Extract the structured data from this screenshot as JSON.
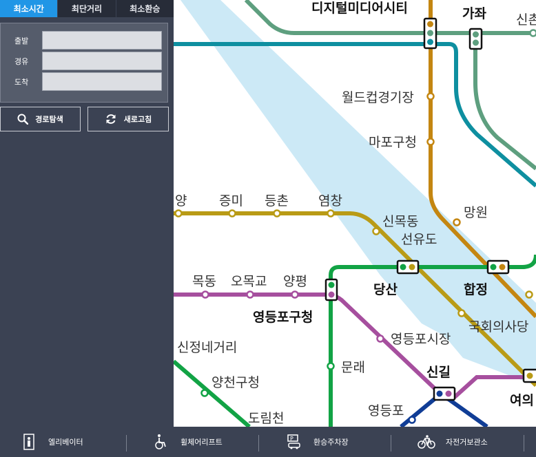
{
  "tabs": [
    {
      "label": "최소시간",
      "active": true
    },
    {
      "label": "최단거리",
      "active": false
    },
    {
      "label": "최소환승",
      "active": false
    }
  ],
  "route": {
    "departure_label": "출발",
    "via_label": "경유",
    "arrival_label": "도착",
    "departure_value": "",
    "via_value": "",
    "arrival_value": ""
  },
  "buttons": {
    "search_label": "경로탐색",
    "refresh_label": "새로고침"
  },
  "stations": {
    "digital_media_city": "디지털미디어시티",
    "gajwa": "가좌",
    "sinchon": "신촌",
    "world_cup_stadium": "월드컵경기장",
    "mapo_gu_office": "마포구청",
    "mangwon": "망원",
    "yangcheon": "양",
    "jeungmi": "증미",
    "deungchon": "등촌",
    "yeomchang": "염창",
    "sinmokdong": "신목동",
    "seonyudo": "선유도",
    "dangsan": "당산",
    "hapjeong": "합정",
    "mokdong": "목동",
    "omokgyo": "오목교",
    "yangpyeong": "양평",
    "yeongdeungpo_gu_office": "영등포구청",
    "national_assembly": "국회의사당",
    "yeongdeungpo_market": "영등포시장",
    "sinjeong_negeori": "신정네거리",
    "mullae": "문래",
    "singil": "신길",
    "yangcheon_gu_office": "양천구청",
    "yeongdeungpo": "영등포",
    "yeouido": "여의",
    "dorimcheon": "도림천"
  },
  "legend": [
    {
      "label": "엘리베이터",
      "icon": "elevator-icon"
    },
    {
      "label": "휠체어리프트",
      "icon": "wheelchair-lift-icon"
    },
    {
      "label": "환승주차장",
      "icon": "transfer-parking-icon"
    },
    {
      "label": "자전거보관소",
      "icon": "bicycle-storage-icon"
    }
  ],
  "colors": {
    "line2": "#12a345",
    "line5": "#a64f9e",
    "line6": "#c48611",
    "line9": "#b99b16",
    "airport": "#0e8fa0",
    "gyeongui": "#5e9f7f",
    "line1": "#103d96",
    "river": "#cce9f6",
    "accent": "#2196e6"
  }
}
